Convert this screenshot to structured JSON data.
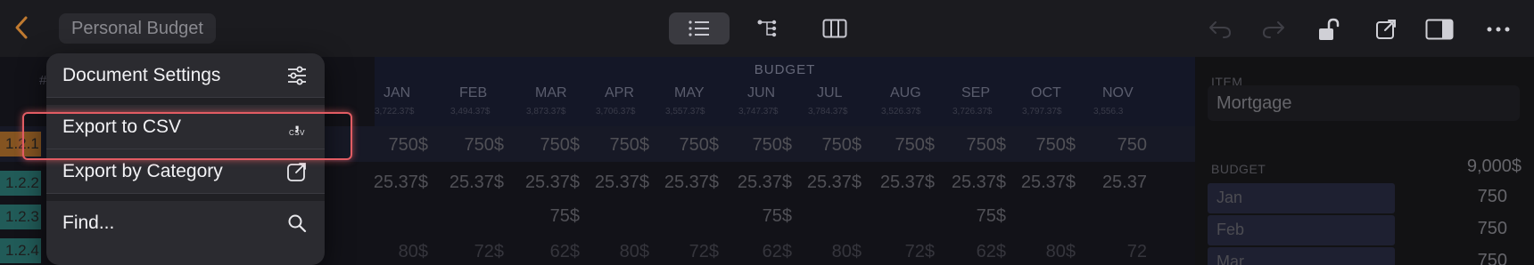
{
  "toolbar": {
    "back_icon": "chevron-left-icon",
    "doc_title": "Personal Budget",
    "views": [
      "list-view-icon",
      "tree-view-icon",
      "columns-view-icon"
    ],
    "right_icons": [
      "undo-icon",
      "redo-icon",
      "unlock-icon",
      "share-icon",
      "sidebar-icon",
      "more-icon"
    ]
  },
  "sheet": {
    "hash_header": "#",
    "group_header": "BUDGET",
    "months": [
      "JAN",
      "FEB",
      "MAR",
      "APR",
      "MAY",
      "JUN",
      "JUL",
      "AUG",
      "SEP",
      "OCT",
      "NOV"
    ],
    "month_totals": [
      "3,722.37$",
      "3,494.37$",
      "3,873.37$",
      "3,706.37$",
      "3,557.37$",
      "3,747.37$",
      "3,784.37$",
      "3,526.37$",
      "3,726.37$",
      "3,797.37$",
      "3,556.3"
    ],
    "row_ids": [
      "1.2.1",
      "1.2.2",
      "1.2.3",
      "1.2.4"
    ],
    "row1": [
      "750$",
      "750$",
      "750$",
      "750$",
      "750$",
      "750$",
      "750$",
      "750$",
      "750$",
      "750$",
      "750"
    ],
    "row2": [
      "25.37$",
      "25.37$",
      "25.37$",
      "25.37$",
      "25.37$",
      "25.37$",
      "25.37$",
      "25.37$",
      "25.37$",
      "25.37$",
      "25.37"
    ],
    "row3": [
      "",
      "",
      "75$",
      "",
      "",
      "75$",
      "",
      "",
      "75$",
      "",
      ""
    ],
    "row4": [
      "80$",
      "72$",
      "62$",
      "80$",
      "72$",
      "62$",
      "80$",
      "72$",
      "62$",
      "80$",
      "72"
    ]
  },
  "inspector": {
    "item_label": "ITEM",
    "item_value": "Mortgage",
    "budget_label": "BUDGET",
    "budget_value": "9,000$",
    "months": [
      {
        "name": "Jan",
        "value": "750"
      },
      {
        "name": "Feb",
        "value": "750"
      },
      {
        "name": "Mar",
        "value": "750"
      }
    ]
  },
  "menu": {
    "items": [
      {
        "label": "Document Settings",
        "icon": "sliders-icon"
      },
      {
        "label": "Export to CSV",
        "icon": "csv-export-icon",
        "csv_tag": "CSV"
      },
      {
        "label": "Export by Category",
        "icon": "share-arrow-icon"
      },
      {
        "label": "Find...",
        "icon": "search-icon"
      }
    ]
  },
  "colors": {
    "accent": "#c07a30",
    "highlight": "#e25c63",
    "row_tag_orange": "#b8752e",
    "row_tag_teal": "#2f7f7a"
  }
}
